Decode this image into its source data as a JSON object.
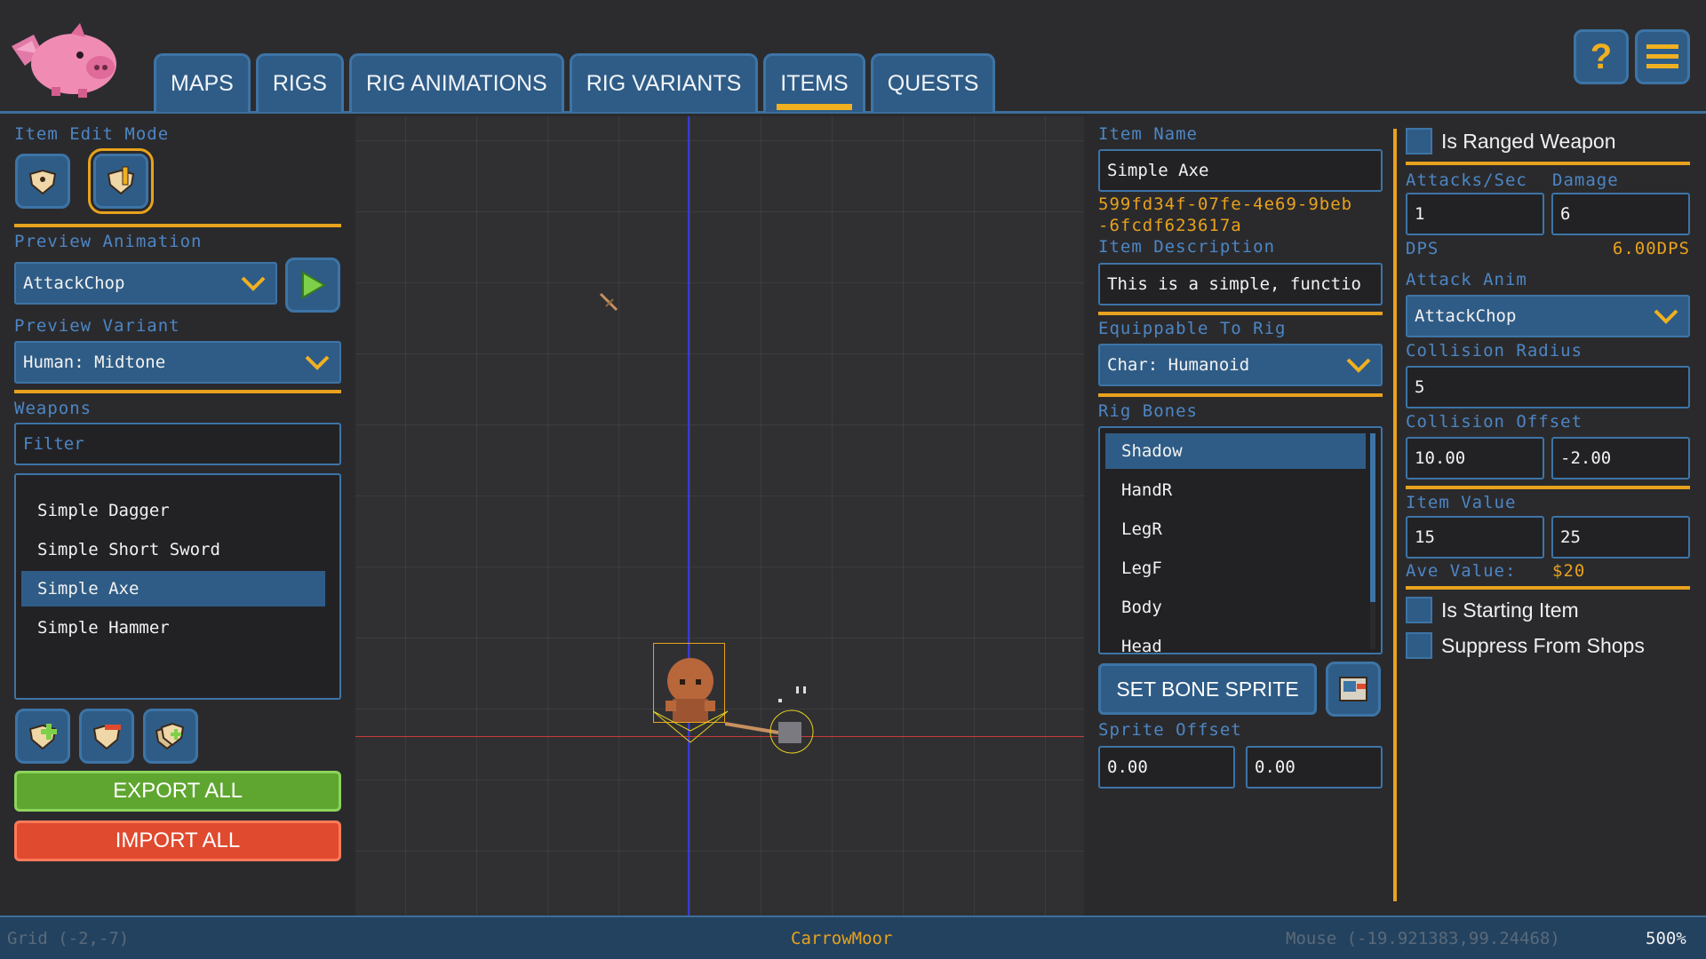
{
  "tabs": [
    {
      "label": "MAPS",
      "active": false
    },
    {
      "label": "RIGS",
      "active": false
    },
    {
      "label": "RIG ANIMATIONS",
      "active": false
    },
    {
      "label": "RIG VARIANTS",
      "active": false
    },
    {
      "label": "ITEMS",
      "active": true
    },
    {
      "label": "QUESTS",
      "active": false
    }
  ],
  "left": {
    "item_edit_mode_label": "Item Edit Mode",
    "preview_animation_label": "Preview Animation",
    "preview_animation_value": "AttackChop",
    "preview_variant_label": "Preview Variant",
    "preview_variant_value": "Human: Midtone",
    "weapons_label": "Weapons",
    "filter_placeholder": "Filter",
    "weapons": [
      "Simple Dagger",
      "Simple Short Sword",
      "Simple Axe",
      "Simple Hammer"
    ],
    "selected_weapon": "Simple Axe",
    "export_label": "EXPORT ALL",
    "import_label": "IMPORT ALL"
  },
  "mid": {
    "item_name_label": "Item Name",
    "item_name_value": "Simple Axe",
    "item_guid_line1": "599fd34f-07fe-4e69-9beb",
    "item_guid_line2": "-6fcdf623617a",
    "item_description_label": "Item Description",
    "item_description_value": "This is a simple, functio",
    "equippable_label": "Equippable To Rig",
    "equippable_value": "Char: Humanoid",
    "rig_bones_label": "Rig Bones",
    "rig_bones": [
      "Shadow",
      "HandR",
      "LegR",
      "LegF",
      "Body",
      "Head"
    ],
    "selected_bone": "Shadow",
    "set_bone_sprite_label": "SET BONE SPRITE",
    "sprite_offset_label": "Sprite Offset",
    "sprite_offset_x": "0.00",
    "sprite_offset_y": "0.00"
  },
  "right": {
    "is_ranged_label": "Is Ranged Weapon",
    "attacks_per_sec_label": "Attacks/Sec",
    "damage_label": "Damage",
    "attacks_per_sec_value": "1",
    "damage_value": "6",
    "dps_label": "DPS",
    "dps_value": "6.00DPS",
    "attack_anim_label": "Attack Anim",
    "attack_anim_value": "AttackChop",
    "collision_radius_label": "Collision Radius",
    "collision_radius_value": "5",
    "collision_offset_label": "Collision Offset",
    "collision_offset_x": "10.00",
    "collision_offset_y": "-2.00",
    "item_value_label": "Item Value",
    "item_value_min": "15",
    "item_value_max": "25",
    "ave_value_label": "Ave Value:",
    "ave_value": "$20",
    "is_starting_label": "Is Starting Item",
    "suppress_label": "Suppress From Shops"
  },
  "status": {
    "grid": "Grid (-2,-7)",
    "map_name": "CarrowMoor",
    "mouse": "Mouse (-19.921383,99.24468)",
    "zoom": "500%"
  },
  "colors": {
    "accent_blue": "#2f5c86",
    "accent_orange": "#e8a21d",
    "export_green": "#5fa631",
    "import_red": "#e04a2e"
  }
}
